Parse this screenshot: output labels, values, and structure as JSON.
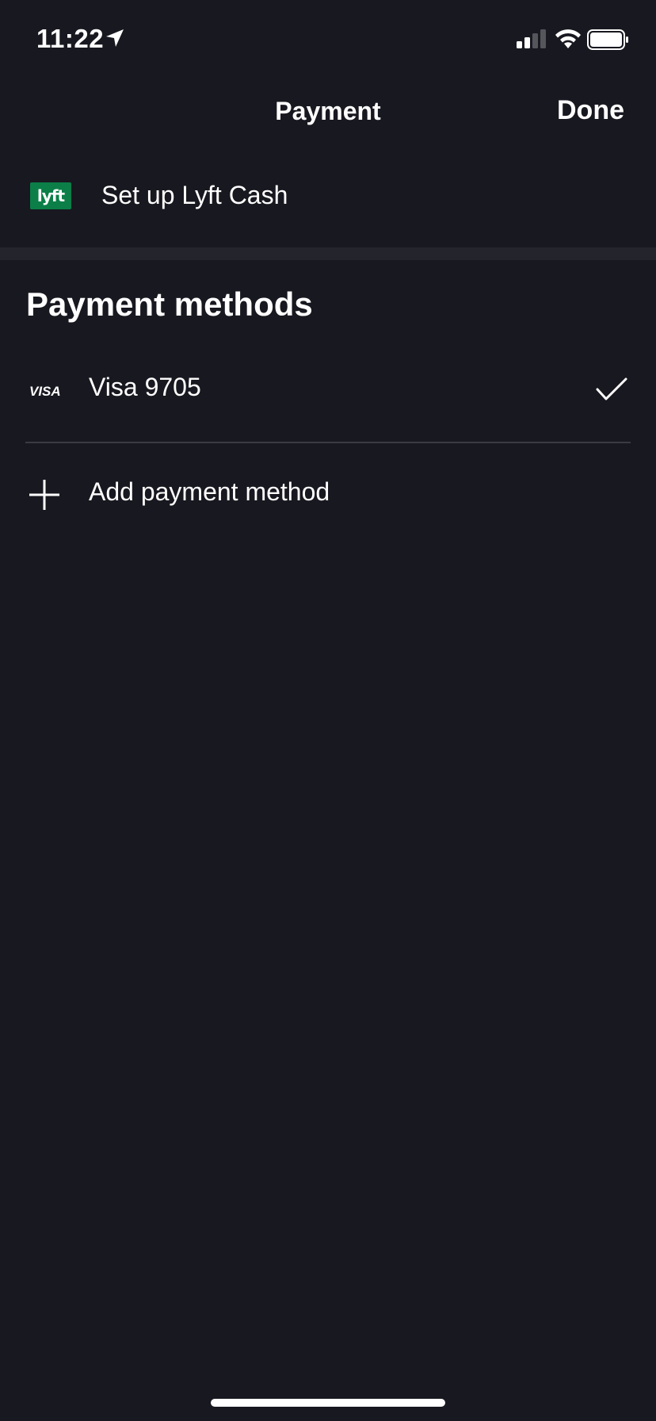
{
  "status_bar": {
    "time": "11:22",
    "icons": [
      "location-arrow-icon",
      "signal-icon",
      "wifi-icon",
      "battery-icon"
    ]
  },
  "nav": {
    "title": "Payment",
    "done_label": "Done"
  },
  "lyft_cash": {
    "logo_text": "lyft",
    "label": "Set up Lyft Cash"
  },
  "payment_methods": {
    "heading": "Payment methods",
    "items": [
      {
        "brand": "VISA",
        "label": "Visa 9705",
        "selected": true
      }
    ],
    "add_label": "Add payment method"
  },
  "colors": {
    "background": "#181820",
    "section_gap": "#24242c",
    "lyft_green": "#0b7f47",
    "text": "#ffffff",
    "divider": "#3b3b44"
  }
}
